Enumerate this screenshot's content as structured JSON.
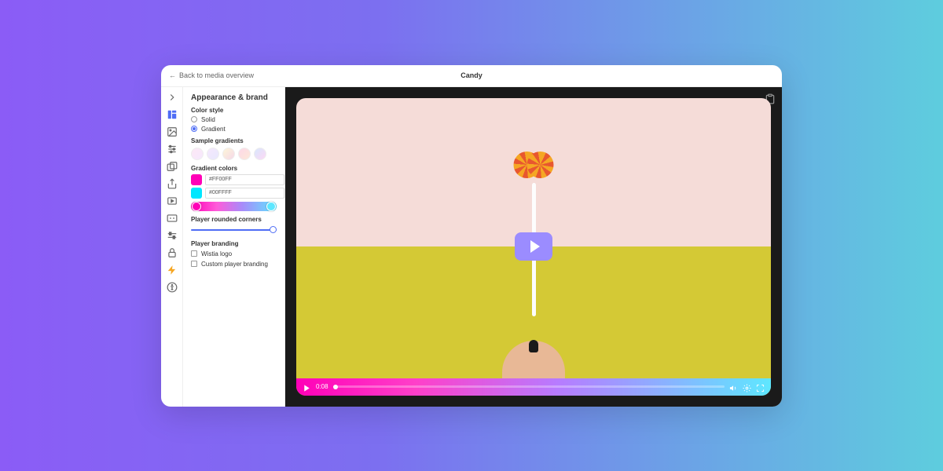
{
  "header": {
    "back_label": "Back to media overview",
    "title": "Candy"
  },
  "iconbar": {
    "items": [
      "chevron-right",
      "appearance",
      "image",
      "controls",
      "overlay",
      "share",
      "actions",
      "captions",
      "timeline",
      "lock",
      "integrations",
      "accessibility"
    ],
    "active_index": 1
  },
  "panel": {
    "title": "Appearance & brand",
    "color_style_label": "Color style",
    "color_style_options": [
      "Solid",
      "Gradient"
    ],
    "color_style_value": "Gradient",
    "sample_gradients_label": "Sample gradients",
    "sample_gradients": [
      "linear-gradient(135deg,#fde8f5,#f5e8fd)",
      "linear-gradient(135deg,#f5e8fd,#e8e8fd)",
      "linear-gradient(135deg,#fdf5d8,#f5d8e8)",
      "linear-gradient(135deg,#fdd8e8,#fde8d8)",
      "linear-gradient(135deg,#d8e8fd,#fdd8f5)"
    ],
    "gradient_colors_label": "Gradient colors",
    "color1": {
      "hex": "#FF00FF",
      "chip": "#ff00b7"
    },
    "color2": {
      "hex": "#00FFFF",
      "chip": "#00e7ff"
    },
    "rounded_label": "Player rounded corners",
    "branding_label": "Player branding",
    "branding_options": [
      "Wistia logo",
      "Custom player branding"
    ]
  },
  "player": {
    "current_time": "0:08"
  }
}
